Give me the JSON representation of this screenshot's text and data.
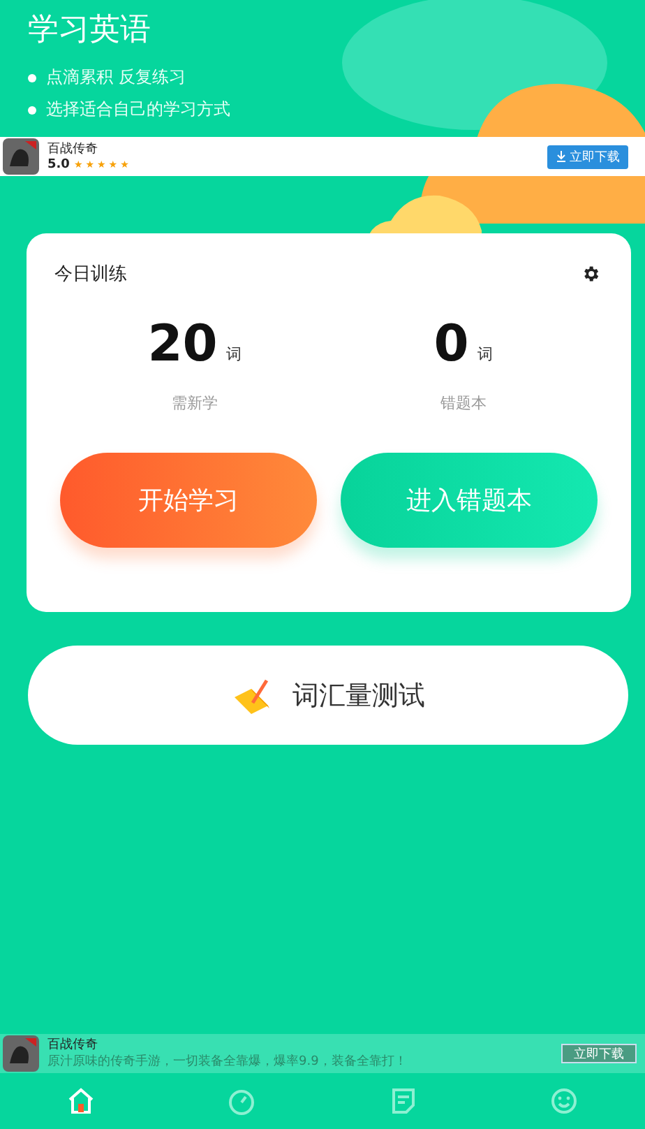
{
  "header": {
    "title": "学习英语",
    "bullets": [
      "点滴累积 反复练习",
      "选择适合自己的学习方式"
    ]
  },
  "top_ad": {
    "name": "百战传奇",
    "rating": "5.0",
    "stars": 5,
    "button": "立即下载"
  },
  "training": {
    "title": "今日训练",
    "stats": [
      {
        "value": "20",
        "unit": "词",
        "label": "需新学"
      },
      {
        "value": "0",
        "unit": "词",
        "label": "错题本"
      }
    ],
    "buttons": [
      {
        "label": "开始学习",
        "kind": "orange"
      },
      {
        "label": "进入错题本",
        "kind": "green"
      }
    ]
  },
  "vocab_test": {
    "label": "词汇量测试"
  },
  "bottom_ad": {
    "name": "百战传奇",
    "text": "原汁原味的传奇手游，一切装备全靠爆，爆率9.9，装备全靠打！",
    "button": "立即下载"
  },
  "nav": [
    {
      "kind": "home",
      "selected": true
    },
    {
      "kind": "timer",
      "selected": false
    },
    {
      "kind": "note",
      "selected": false
    },
    {
      "kind": "smile",
      "selected": false
    }
  ]
}
